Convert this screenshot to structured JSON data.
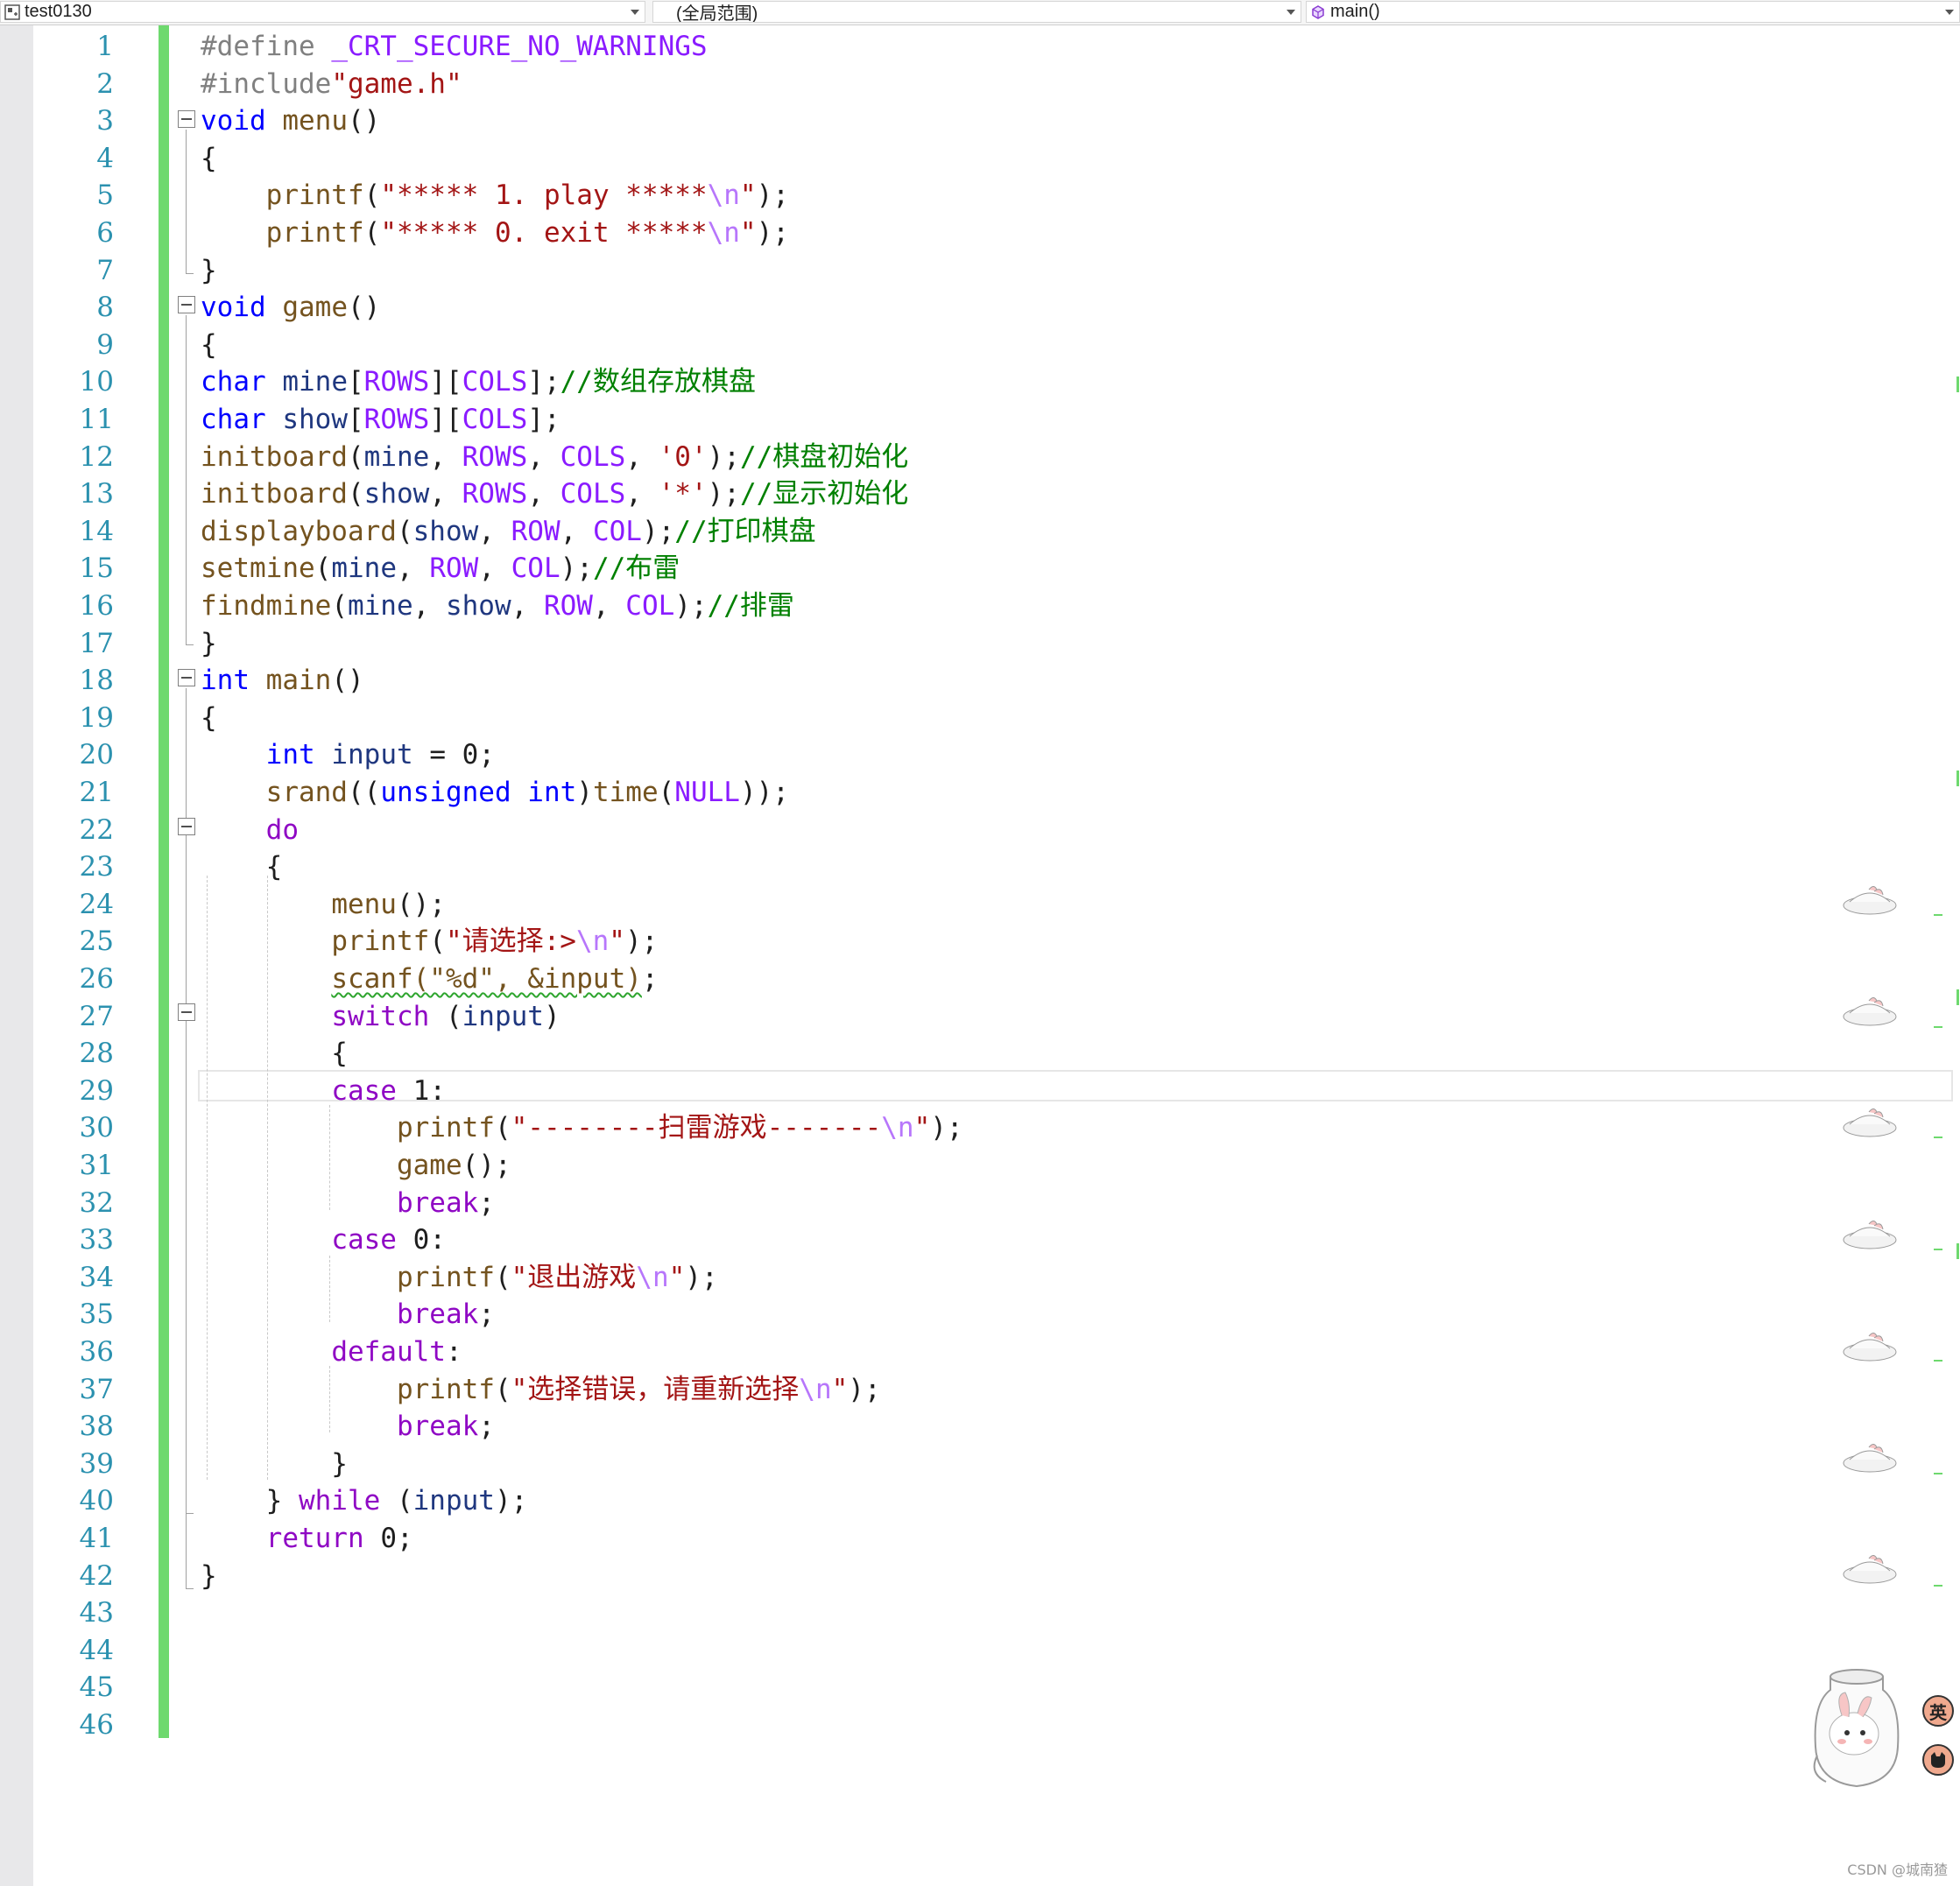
{
  "nav": {
    "project": "test0130",
    "scope": "(全局范围)",
    "member": "main()"
  },
  "watermark": "CSDN @城南猹",
  "ime": {
    "lang_label": "英",
    "settings_icon": "cat-icon"
  },
  "lines": [
    {
      "n": "1",
      "tokens": [
        [
          "pp",
          "#define "
        ],
        [
          "mac",
          "_CRT_SECURE_NO_WARNINGS"
        ]
      ]
    },
    {
      "n": "2",
      "tokens": [
        [
          "pp",
          "#include"
        ],
        [
          "str",
          "\"game.h\""
        ]
      ]
    },
    {
      "n": "3",
      "tokens": [
        [
          "kw",
          "void"
        ],
        [
          "pl",
          " "
        ],
        [
          "fn",
          "menu"
        ],
        [
          "pl",
          "()"
        ]
      ]
    },
    {
      "n": "4",
      "tokens": [
        [
          "pl",
          "{"
        ]
      ]
    },
    {
      "n": "5",
      "tokens": [
        [
          "pl",
          "    "
        ],
        [
          "fn",
          "printf"
        ],
        [
          "pl",
          "("
        ],
        [
          "str",
          "\"***** 1. play *****"
        ],
        [
          "esc",
          "\\n"
        ],
        [
          "str",
          "\""
        ],
        [
          "pl",
          ");"
        ]
      ]
    },
    {
      "n": "6",
      "tokens": [
        [
          "pl",
          "    "
        ],
        [
          "fn",
          "printf"
        ],
        [
          "pl",
          "("
        ],
        [
          "str",
          "\"***** 0. exit *****"
        ],
        [
          "esc",
          "\\n"
        ],
        [
          "str",
          "\""
        ],
        [
          "pl",
          ");"
        ]
      ]
    },
    {
      "n": "7",
      "tokens": [
        [
          "pl",
          "}"
        ]
      ]
    },
    {
      "n": "8",
      "tokens": [
        [
          "kw",
          "void"
        ],
        [
          "pl",
          " "
        ],
        [
          "fn",
          "game"
        ],
        [
          "pl",
          "()"
        ]
      ]
    },
    {
      "n": "9",
      "tokens": [
        [
          "pl",
          "{"
        ]
      ]
    },
    {
      "n": "10",
      "tokens": [
        [
          "kw",
          "char"
        ],
        [
          "pl",
          " "
        ],
        [
          "var",
          "mine"
        ],
        [
          "pl",
          "["
        ],
        [
          "mac",
          "ROWS"
        ],
        [
          "pl",
          "]["
        ],
        [
          "mac",
          "COLS"
        ],
        [
          "pl",
          "];"
        ],
        [
          "cmt",
          "//数组存放棋盘"
        ]
      ]
    },
    {
      "n": "11",
      "tokens": [
        [
          "kw",
          "char"
        ],
        [
          "pl",
          " "
        ],
        [
          "var",
          "show"
        ],
        [
          "pl",
          "["
        ],
        [
          "mac",
          "ROWS"
        ],
        [
          "pl",
          "]["
        ],
        [
          "mac",
          "COLS"
        ],
        [
          "pl",
          "];"
        ]
      ]
    },
    {
      "n": "12",
      "tokens": [
        [
          "fn",
          "initboard"
        ],
        [
          "pl",
          "("
        ],
        [
          "var",
          "mine"
        ],
        [
          "pl",
          ", "
        ],
        [
          "mac",
          "ROWS"
        ],
        [
          "pl",
          ", "
        ],
        [
          "mac",
          "COLS"
        ],
        [
          "pl",
          ", "
        ],
        [
          "str",
          "'0'"
        ],
        [
          "pl",
          ");"
        ],
        [
          "cmt",
          "//棋盘初始化"
        ]
      ]
    },
    {
      "n": "13",
      "tokens": [
        [
          "fn",
          "initboard"
        ],
        [
          "pl",
          "("
        ],
        [
          "var",
          "show"
        ],
        [
          "pl",
          ", "
        ],
        [
          "mac",
          "ROWS"
        ],
        [
          "pl",
          ", "
        ],
        [
          "mac",
          "COLS"
        ],
        [
          "pl",
          ", "
        ],
        [
          "str",
          "'*'"
        ],
        [
          "pl",
          ");"
        ],
        [
          "cmt",
          "//显示初始化"
        ]
      ]
    },
    {
      "n": "14",
      "tokens": [
        [
          "fn",
          "displayboard"
        ],
        [
          "pl",
          "("
        ],
        [
          "var",
          "show"
        ],
        [
          "pl",
          ", "
        ],
        [
          "mac",
          "ROW"
        ],
        [
          "pl",
          ", "
        ],
        [
          "mac",
          "COL"
        ],
        [
          "pl",
          ");"
        ],
        [
          "cmt",
          "//打印棋盘"
        ]
      ]
    },
    {
      "n": "15",
      "tokens": [
        [
          "fn",
          "setmine"
        ],
        [
          "pl",
          "("
        ],
        [
          "var",
          "mine"
        ],
        [
          "pl",
          ", "
        ],
        [
          "mac",
          "ROW"
        ],
        [
          "pl",
          ", "
        ],
        [
          "mac",
          "COL"
        ],
        [
          "pl",
          ");"
        ],
        [
          "cmt",
          "//布雷"
        ]
      ]
    },
    {
      "n": "16",
      "tokens": [
        [
          "fn",
          "findmine"
        ],
        [
          "pl",
          "("
        ],
        [
          "var",
          "mine"
        ],
        [
          "pl",
          ", "
        ],
        [
          "var",
          "show"
        ],
        [
          "pl",
          ", "
        ],
        [
          "mac",
          "ROW"
        ],
        [
          "pl",
          ", "
        ],
        [
          "mac",
          "COL"
        ],
        [
          "pl",
          ");"
        ],
        [
          "cmt",
          "//排雷"
        ]
      ]
    },
    {
      "n": "17",
      "tokens": [
        [
          "pl",
          "}"
        ]
      ]
    },
    {
      "n": "18",
      "tokens": [
        [
          "kw",
          "int"
        ],
        [
          "pl",
          " "
        ],
        [
          "fn",
          "main"
        ],
        [
          "pl",
          "()"
        ]
      ]
    },
    {
      "n": "19",
      "tokens": [
        [
          "pl",
          "{"
        ]
      ]
    },
    {
      "n": "20",
      "tokens": [
        [
          "pl",
          "    "
        ],
        [
          "kw",
          "int"
        ],
        [
          "pl",
          " "
        ],
        [
          "var",
          "input"
        ],
        [
          "pl",
          " = "
        ],
        [
          "num",
          "0"
        ],
        [
          "pl",
          ";"
        ]
      ]
    },
    {
      "n": "21",
      "tokens": [
        [
          "pl",
          "    "
        ],
        [
          "fn",
          "srand"
        ],
        [
          "pl",
          "(("
        ],
        [
          "kw",
          "unsigned"
        ],
        [
          "pl",
          " "
        ],
        [
          "kw",
          "int"
        ],
        [
          "pl",
          ")"
        ],
        [
          "fn",
          "time"
        ],
        [
          "pl",
          "("
        ],
        [
          "mac",
          "NULL"
        ],
        [
          "pl",
          "));"
        ]
      ]
    },
    {
      "n": "22",
      "tokens": [
        [
          "pl",
          "    "
        ],
        [
          "ctl",
          "do"
        ]
      ]
    },
    {
      "n": "23",
      "tokens": [
        [
          "pl",
          "    {"
        ]
      ]
    },
    {
      "n": "24",
      "tokens": [
        [
          "pl",
          "        "
        ],
        [
          "fn",
          "menu"
        ],
        [
          "pl",
          "();"
        ]
      ]
    },
    {
      "n": "25",
      "tokens": [
        [
          "pl",
          "        "
        ],
        [
          "fn",
          "printf"
        ],
        [
          "pl",
          "("
        ],
        [
          "str",
          "\"请选择:>"
        ],
        [
          "esc",
          "\\n"
        ],
        [
          "str",
          "\""
        ],
        [
          "pl",
          ");"
        ]
      ]
    },
    {
      "n": "26",
      "tokens": [
        [
          "pl",
          "        "
        ],
        [
          "sq",
          "scanf(\"%d\", &input)"
        ],
        [
          "pl",
          ";"
        ]
      ]
    },
    {
      "n": "27",
      "tokens": [
        [
          "pl",
          "        "
        ],
        [
          "ctl",
          "switch"
        ],
        [
          "pl",
          " ("
        ],
        [
          "var",
          "input"
        ],
        [
          "pl",
          ")"
        ]
      ]
    },
    {
      "n": "28",
      "tokens": [
        [
          "pl",
          "        {"
        ]
      ]
    },
    {
      "n": "29",
      "tokens": [
        [
          "pl",
          "        "
        ],
        [
          "ctl",
          "case"
        ],
        [
          "pl",
          " "
        ],
        [
          "num",
          "1"
        ],
        [
          "pl",
          ":"
        ]
      ]
    },
    {
      "n": "30",
      "tokens": [
        [
          "pl",
          "            "
        ],
        [
          "fn",
          "printf"
        ],
        [
          "pl",
          "("
        ],
        [
          "str",
          "\"--------扫雷游戏-------"
        ],
        [
          "esc",
          "\\n"
        ],
        [
          "str",
          "\""
        ],
        [
          "pl",
          ");"
        ]
      ]
    },
    {
      "n": "31",
      "tokens": [
        [
          "pl",
          "            "
        ],
        [
          "fn",
          "game"
        ],
        [
          "pl",
          "();"
        ]
      ]
    },
    {
      "n": "32",
      "tokens": [
        [
          "pl",
          "            "
        ],
        [
          "ctl",
          "break"
        ],
        [
          "pl",
          ";"
        ]
      ]
    },
    {
      "n": "33",
      "tokens": [
        [
          "pl",
          "        "
        ],
        [
          "ctl",
          "case"
        ],
        [
          "pl",
          " "
        ],
        [
          "num",
          "0"
        ],
        [
          "pl",
          ":"
        ]
      ]
    },
    {
      "n": "34",
      "tokens": [
        [
          "pl",
          "            "
        ],
        [
          "fn",
          "printf"
        ],
        [
          "pl",
          "("
        ],
        [
          "str",
          "\"退出游戏"
        ],
        [
          "esc",
          "\\n"
        ],
        [
          "str",
          "\""
        ],
        [
          "pl",
          ");"
        ]
      ]
    },
    {
      "n": "35",
      "tokens": [
        [
          "pl",
          "            "
        ],
        [
          "ctl",
          "break"
        ],
        [
          "pl",
          ";"
        ]
      ]
    },
    {
      "n": "36",
      "tokens": [
        [
          "pl",
          "        "
        ],
        [
          "ctl",
          "default"
        ],
        [
          "pl",
          ":"
        ]
      ]
    },
    {
      "n": "37",
      "tokens": [
        [
          "pl",
          "            "
        ],
        [
          "fn",
          "printf"
        ],
        [
          "pl",
          "("
        ],
        [
          "str",
          "\"选择错误，请重新选择"
        ],
        [
          "esc",
          "\\n"
        ],
        [
          "str",
          "\""
        ],
        [
          "pl",
          ");"
        ]
      ]
    },
    {
      "n": "38",
      "tokens": [
        [
          "pl",
          "            "
        ],
        [
          "ctl",
          "break"
        ],
        [
          "pl",
          ";"
        ]
      ]
    },
    {
      "n": "39",
      "tokens": [
        [
          "pl",
          "        }"
        ]
      ]
    },
    {
      "n": "40",
      "tokens": [
        [
          "pl",
          "    } "
        ],
        [
          "ctl",
          "while"
        ],
        [
          "pl",
          " ("
        ],
        [
          "var",
          "input"
        ],
        [
          "pl",
          ");"
        ]
      ]
    },
    {
      "n": "41",
      "tokens": [
        [
          "pl",
          "    "
        ],
        [
          "ctl",
          "return"
        ],
        [
          "pl",
          " "
        ],
        [
          "num",
          "0"
        ],
        [
          "pl",
          ";"
        ]
      ]
    },
    {
      "n": "42",
      "tokens": [
        [
          "pl",
          "}"
        ]
      ]
    },
    {
      "n": "43",
      "tokens": []
    },
    {
      "n": "44",
      "tokens": []
    },
    {
      "n": "45",
      "tokens": []
    },
    {
      "n": "46",
      "tokens": []
    }
  ]
}
